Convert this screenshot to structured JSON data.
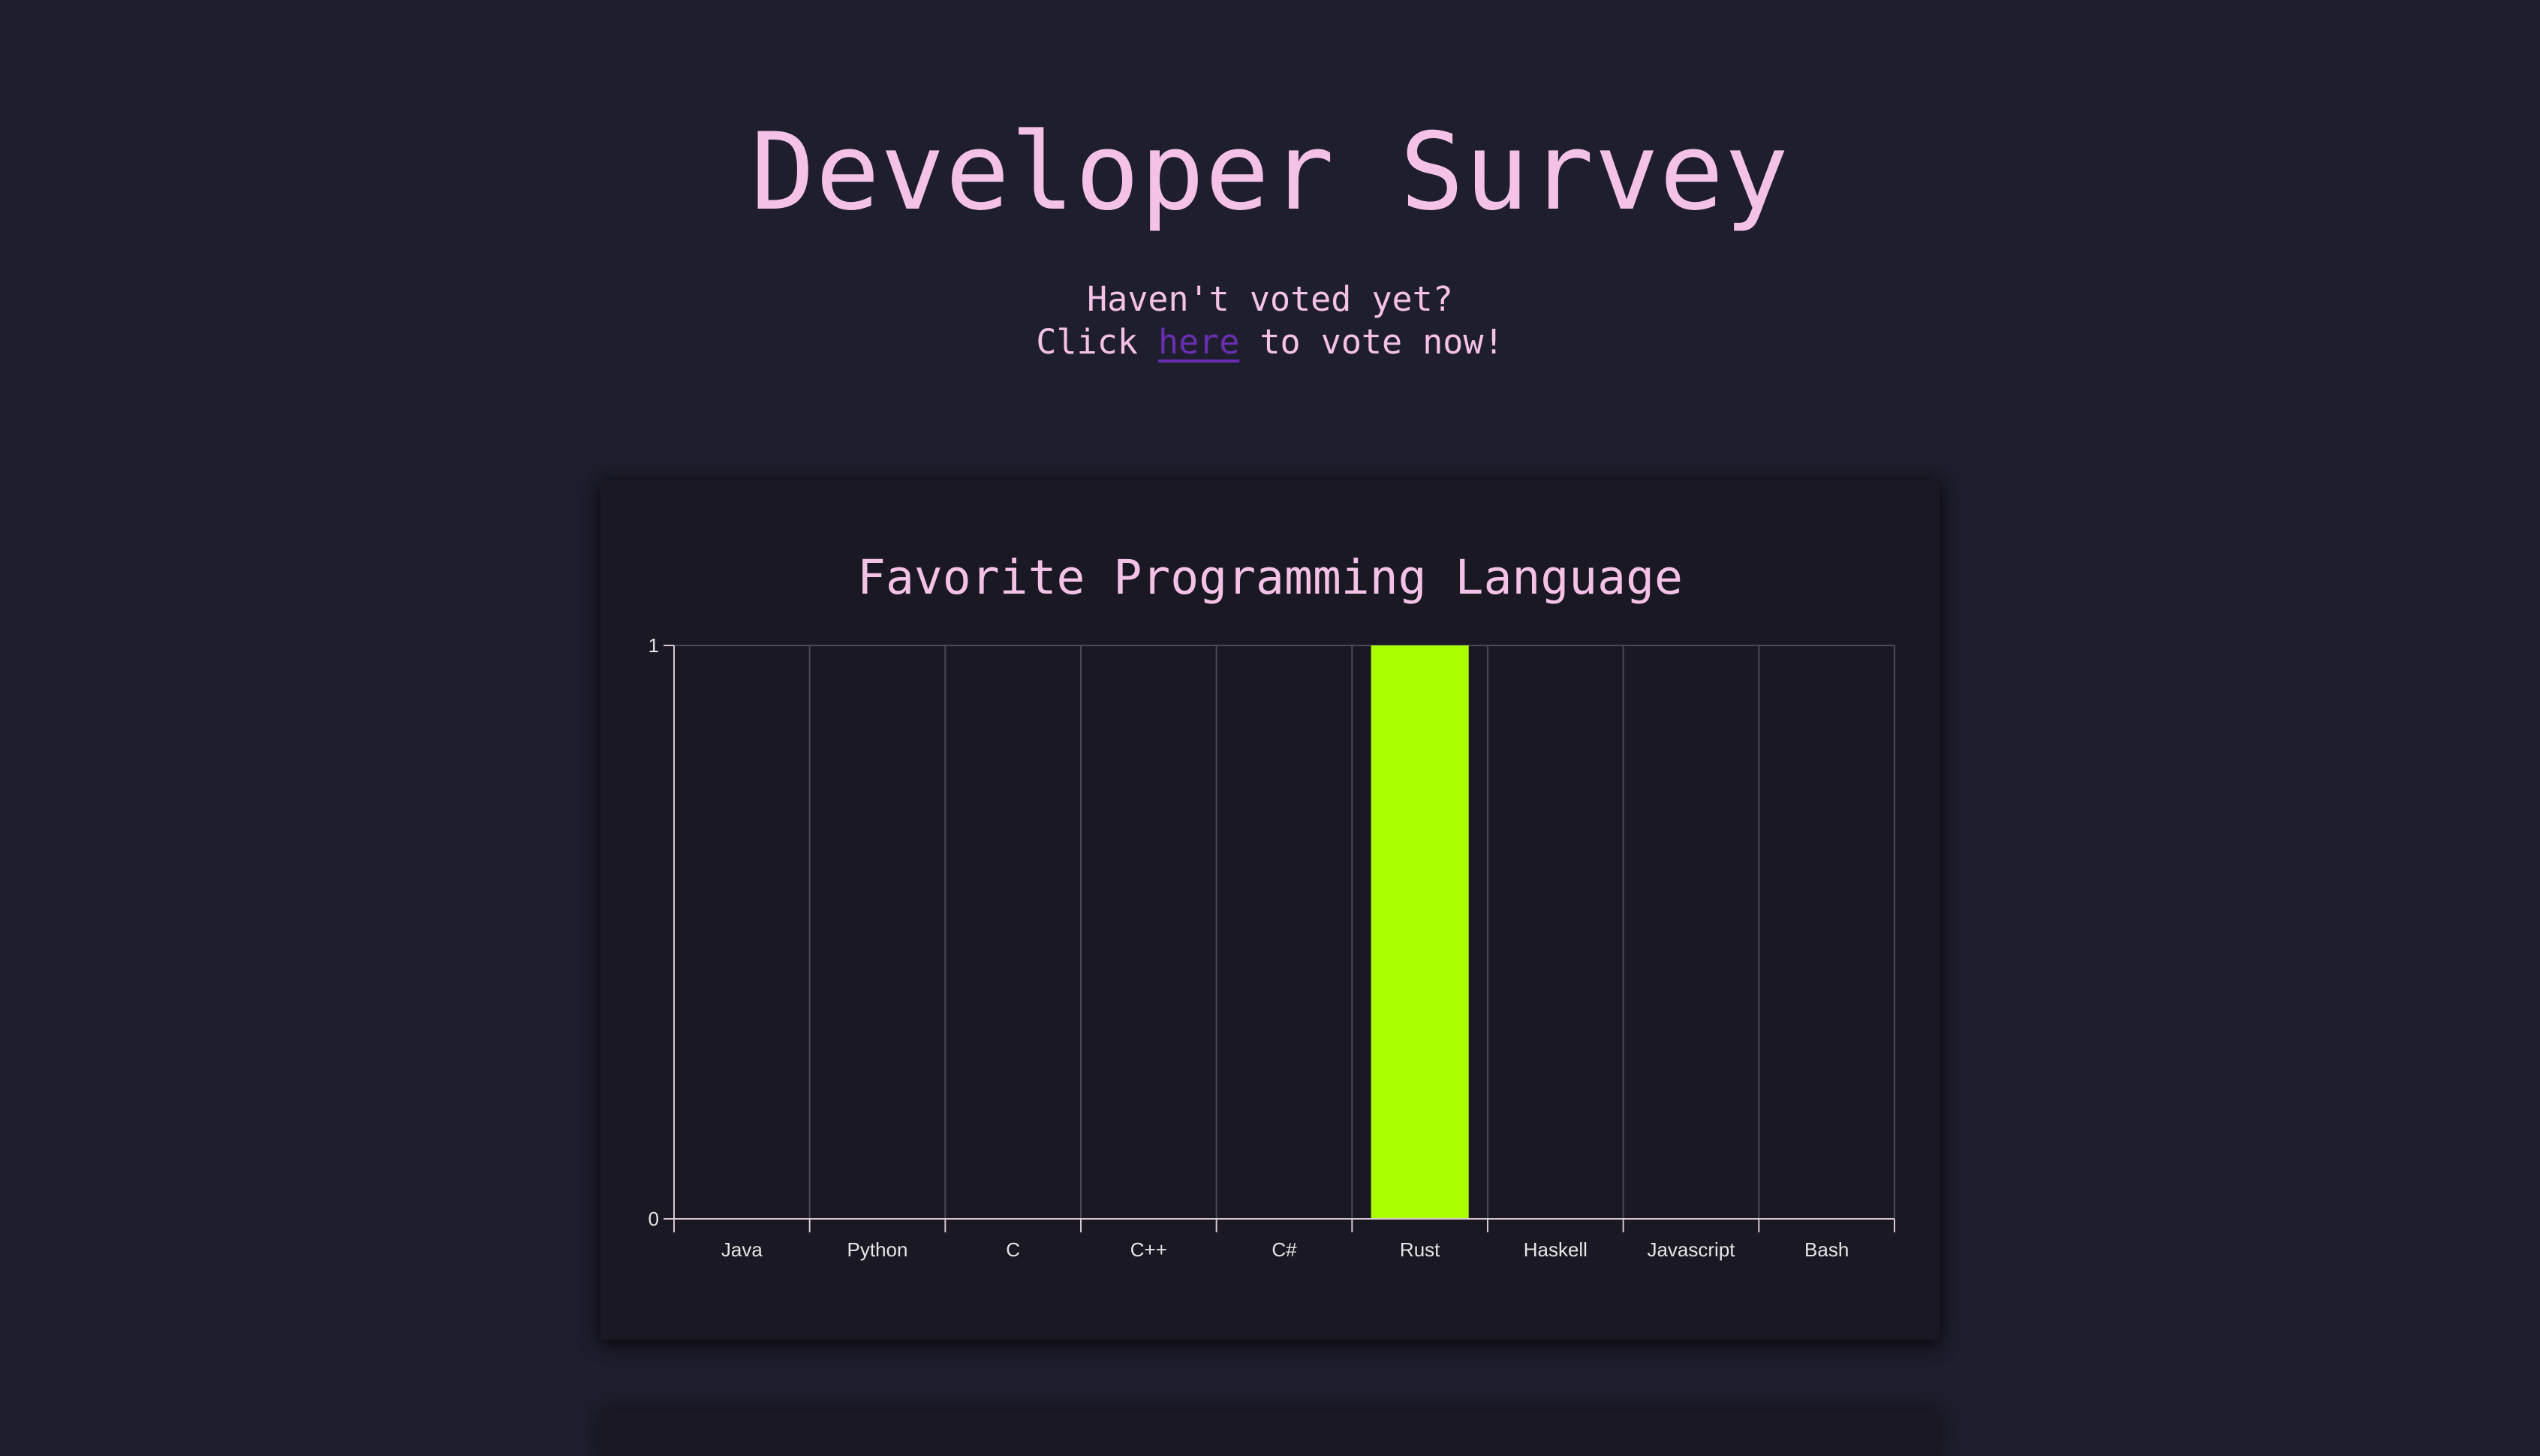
{
  "header": {
    "title": "Developer Survey",
    "intro_line1": "Haven't voted yet?",
    "intro_click": "Click",
    "intro_link": "here",
    "intro_rest": "to vote now!"
  },
  "colors": {
    "background": "#1f1e2e",
    "card": "#191823",
    "text": "#f5c2e7",
    "link": "#6a2fb0",
    "bar": "#aaff00",
    "grid": "#4a4a56",
    "axis": "#d8c8d4"
  },
  "chart_data": {
    "type": "bar",
    "title": "Favorite Programming Language",
    "categories": [
      "Java",
      "Python",
      "C",
      "C++",
      "C#",
      "Rust",
      "Haskell",
      "Javascript",
      "Bash"
    ],
    "values": [
      0,
      0,
      0,
      0,
      0,
      1,
      0,
      0,
      0
    ],
    "ylim": [
      0,
      1
    ],
    "yticks": [
      "0",
      "1"
    ],
    "xlabel": "",
    "ylabel": "",
    "grid": true,
    "legend": "none"
  }
}
